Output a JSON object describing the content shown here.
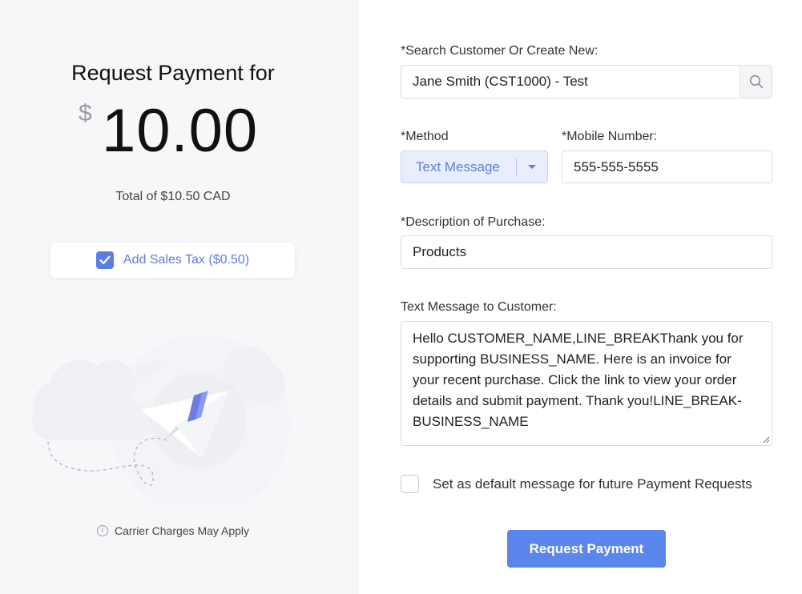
{
  "summary": {
    "title": "Request Payment for",
    "currency_symbol": "$",
    "amount": "10.00",
    "total_text": "Total of $10.50 CAD",
    "tax_checkbox": {
      "label": "Add Sales Tax ($0.50)",
      "checked": true
    },
    "carrier_note": "Carrier Charges May Apply"
  },
  "form": {
    "customer": {
      "label": "*Search Customer Or Create New:",
      "value": "Jane Smith (CST1000) - Test",
      "search_icon": "search-icon"
    },
    "method": {
      "label": "*Method",
      "selected": "Text Message"
    },
    "mobile": {
      "label": "*Mobile Number:",
      "value": "555-555-5555"
    },
    "description": {
      "label": "*Description of Purchase:",
      "value": "Products"
    },
    "message": {
      "label": "Text Message to Customer:",
      "value": "Hello CUSTOMER_NAME,LINE_BREAKThank you for supporting BUSINESS_NAME. Here is an invoice for your recent purchase. Click the link to view your order details and submit payment. Thank you!LINE_BREAK-BUSINESS_NAME"
    },
    "default_message": {
      "label": "Set as default message for future Payment Requests",
      "checked": false
    },
    "submit_label": "Request Payment"
  },
  "colors": {
    "accent": "#5b86ee",
    "left_panel_bg": "#f6f7f9",
    "select_bg": "#e8eefc"
  }
}
